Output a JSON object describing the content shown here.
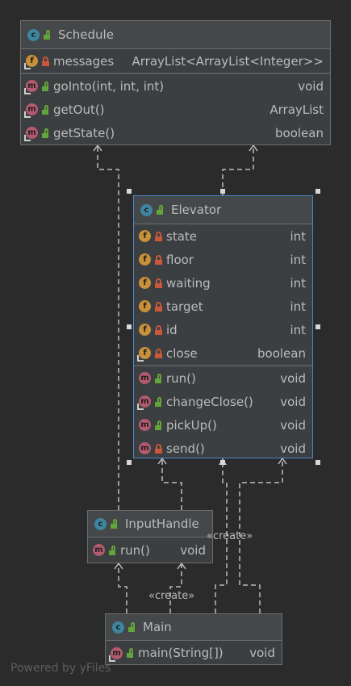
{
  "schedule": {
    "title": "Schedule",
    "fields": [
      {
        "name": "messages",
        "type": "ArrayList<ArrayList<Integer>>"
      }
    ],
    "methods": [
      {
        "name": "goInto(int, int, int)",
        "type": "void"
      },
      {
        "name": "getOut()",
        "type": "ArrayList"
      },
      {
        "name": "getState()",
        "type": "boolean"
      }
    ]
  },
  "elevator": {
    "title": "Elevator",
    "fields": [
      {
        "name": "state",
        "type": "int"
      },
      {
        "name": "floor",
        "type": "int"
      },
      {
        "name": "waiting",
        "type": "int"
      },
      {
        "name": "target",
        "type": "int"
      },
      {
        "name": "id",
        "type": "int"
      },
      {
        "name": "close",
        "type": "boolean"
      }
    ],
    "methods": [
      {
        "name": "run()",
        "type": "void"
      },
      {
        "name": "changeClose()",
        "type": "void"
      },
      {
        "name": "pickUp()",
        "type": "void"
      },
      {
        "name": "send()",
        "type": "void"
      }
    ]
  },
  "inputhandle": {
    "title": "InputHandle",
    "methods": [
      {
        "name": "run()",
        "type": "void"
      }
    ]
  },
  "main": {
    "title": "Main",
    "methods": [
      {
        "name": "main(String[])",
        "type": "void"
      }
    ]
  },
  "labels": {
    "create1": "«create»",
    "create2": "«create»"
  },
  "watermark": "Powered by yFiles",
  "icons": {
    "class": "class-icon",
    "field": "field-icon",
    "method": "method-icon",
    "public": "public-lock-icon",
    "private": "private-lock-icon"
  },
  "colors": {
    "background": "#2b2b2b",
    "box": "#3c3f41",
    "selection": "#4a88c7",
    "class_icon": "#3e86a0",
    "field_icon": "#c8903a",
    "method_icon": "#b35a6e"
  }
}
